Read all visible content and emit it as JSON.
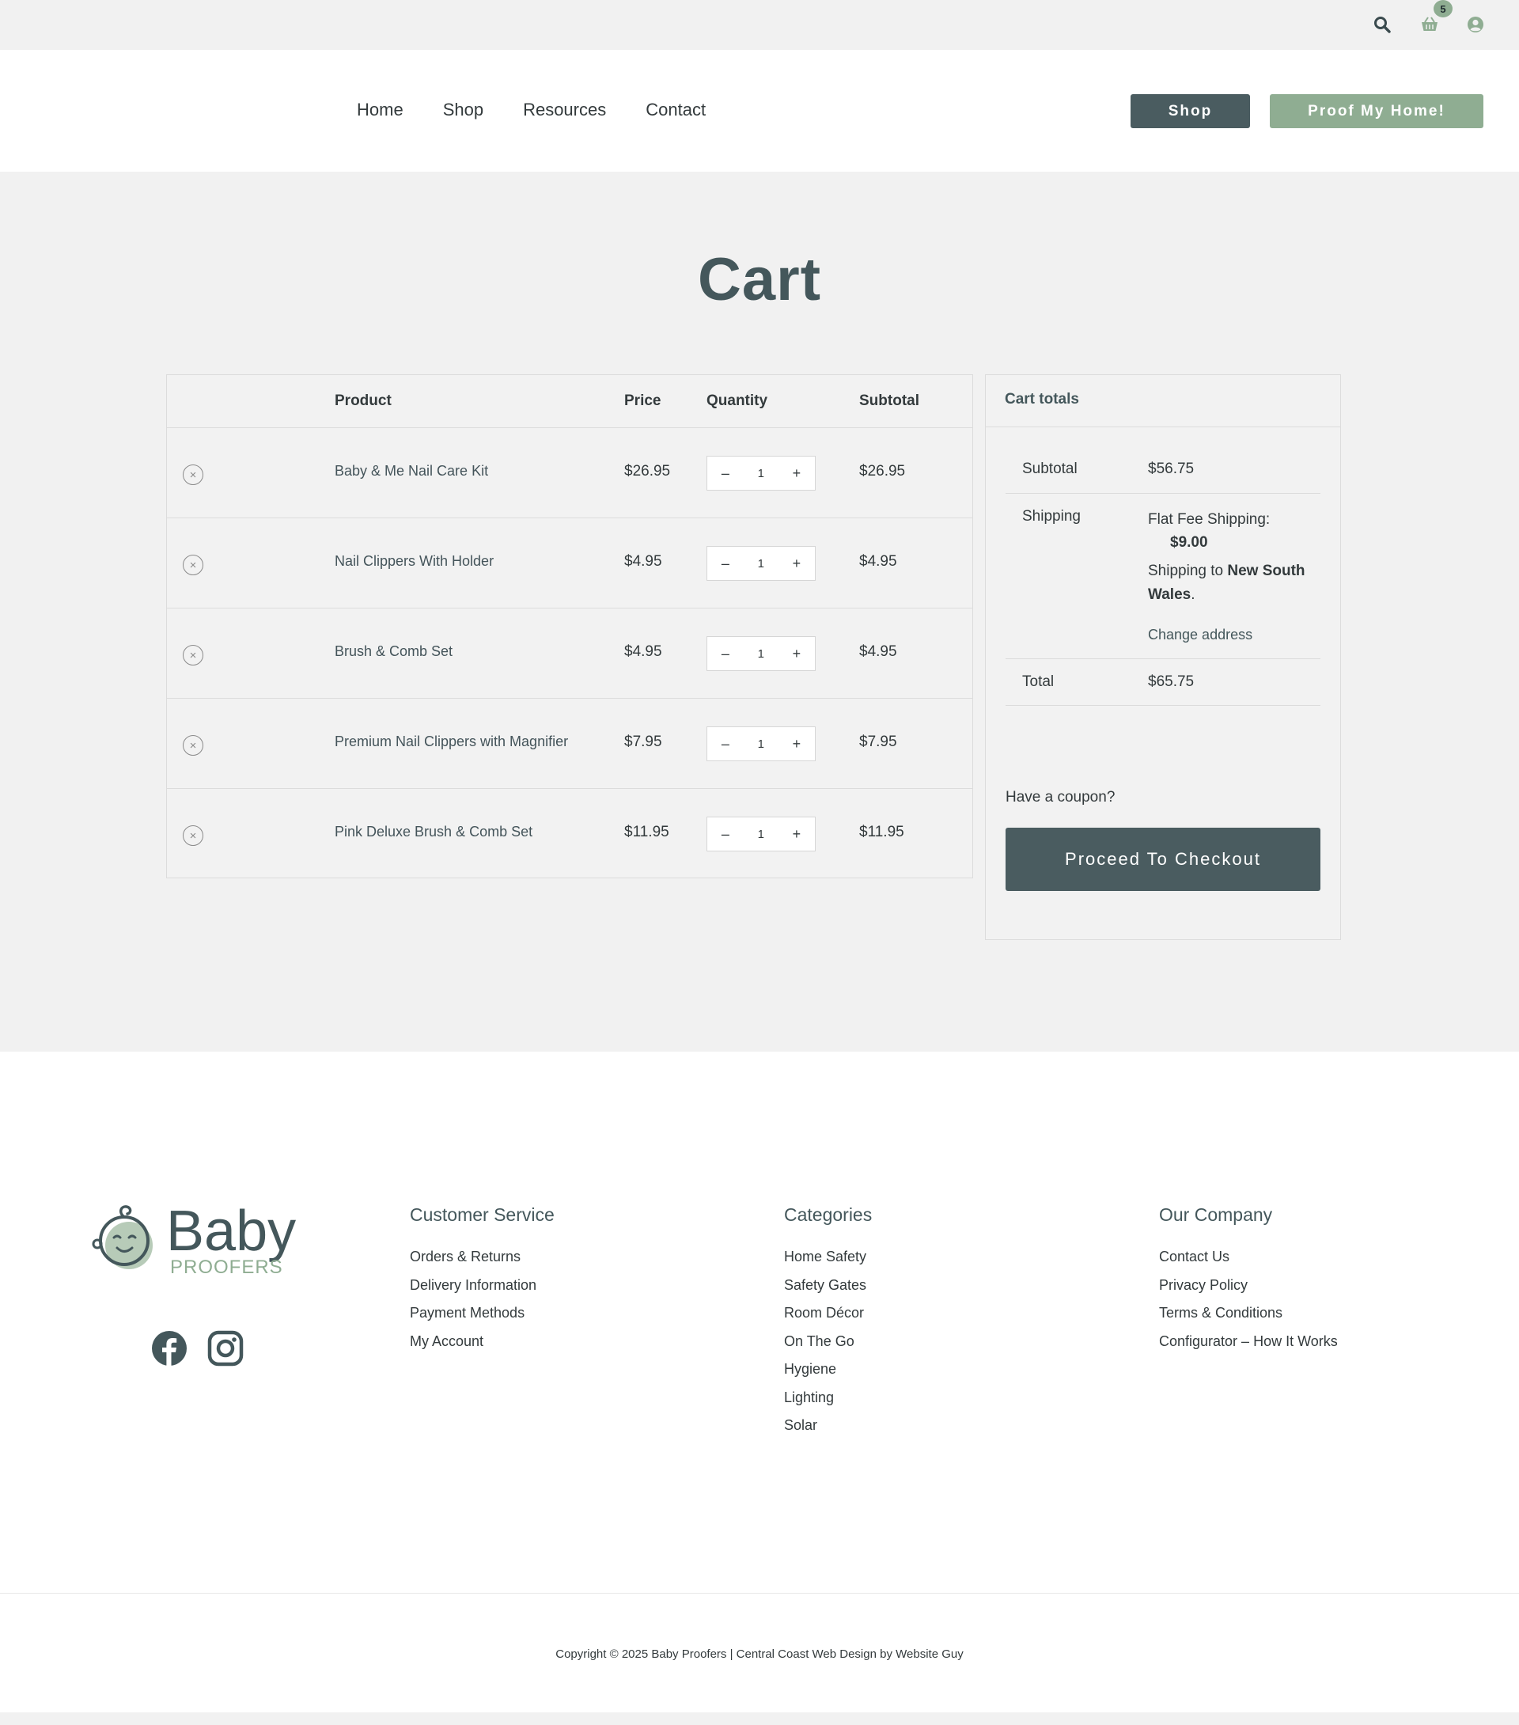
{
  "topbar": {
    "search_icon": "search-icon",
    "cart_icon": "basket-icon",
    "cart_count": "5",
    "user_icon": "user-circle-icon"
  },
  "header": {
    "nav": [
      "Home",
      "Shop",
      "Resources",
      "Contact"
    ],
    "shop_button": "Shop",
    "proof_button": "Proof My Home!"
  },
  "page": {
    "title": "Cart"
  },
  "cart": {
    "columns": {
      "product": "Product",
      "price": "Price",
      "quantity": "Quantity",
      "subtotal": "Subtotal"
    },
    "qty_minus": "–",
    "qty_plus": "+",
    "items": [
      {
        "name": "Baby & Me Nail Care Kit",
        "price": "$26.95",
        "qty": "1",
        "subtotal": "$26.95"
      },
      {
        "name": "Nail Clippers With Holder",
        "price": "$4.95",
        "qty": "1",
        "subtotal": "$4.95"
      },
      {
        "name": "Brush & Comb Set",
        "price": "$4.95",
        "qty": "1",
        "subtotal": "$4.95"
      },
      {
        "name": "Premium Nail Clippers with Magnifier",
        "price": "$7.95",
        "qty": "1",
        "subtotal": "$7.95"
      },
      {
        "name": "Pink Deluxe Brush & Comb Set",
        "price": "$11.95",
        "qty": "1",
        "subtotal": "$11.95"
      }
    ]
  },
  "totals": {
    "heading": "Cart totals",
    "subtotal_label": "Subtotal",
    "subtotal_value": "$56.75",
    "shipping_label": "Shipping",
    "shipping_method": "Flat Fee Shipping:",
    "shipping_price": "$9.00",
    "shipping_to_prefix": "Shipping to",
    "shipping_region": "New South Wales",
    "shipping_to_suffix": ".",
    "change_address": "Change address",
    "total_label": "Total",
    "total_value": "$65.75",
    "coupon": "Have a coupon?",
    "checkout": "Proceed To Checkout"
  },
  "footer": {
    "logo_word": "Baby",
    "logo_sub": "PROOFERS",
    "columns": [
      {
        "heading": "Customer Service",
        "links": [
          "Orders & Returns",
          "Delivery Information",
          "Payment Methods",
          "My Account"
        ]
      },
      {
        "heading": "Categories",
        "links": [
          "Home Safety",
          "Safety Gates",
          "Room Décor",
          "On The Go",
          "Hygiene",
          "Lighting",
          "Solar"
        ]
      },
      {
        "heading": "Our Company",
        "links": [
          "Contact Us",
          "Privacy Policy",
          "Terms & Conditions",
          "Configurator – How It Works"
        ]
      }
    ],
    "copyright": "Copyright © 2025 Baby Proofers | Central Coast Web Design by Website Guy"
  },
  "colors": {
    "accent_dark": "#4a5c60",
    "accent_green": "#8fad92",
    "background": "#f1f1f1"
  }
}
